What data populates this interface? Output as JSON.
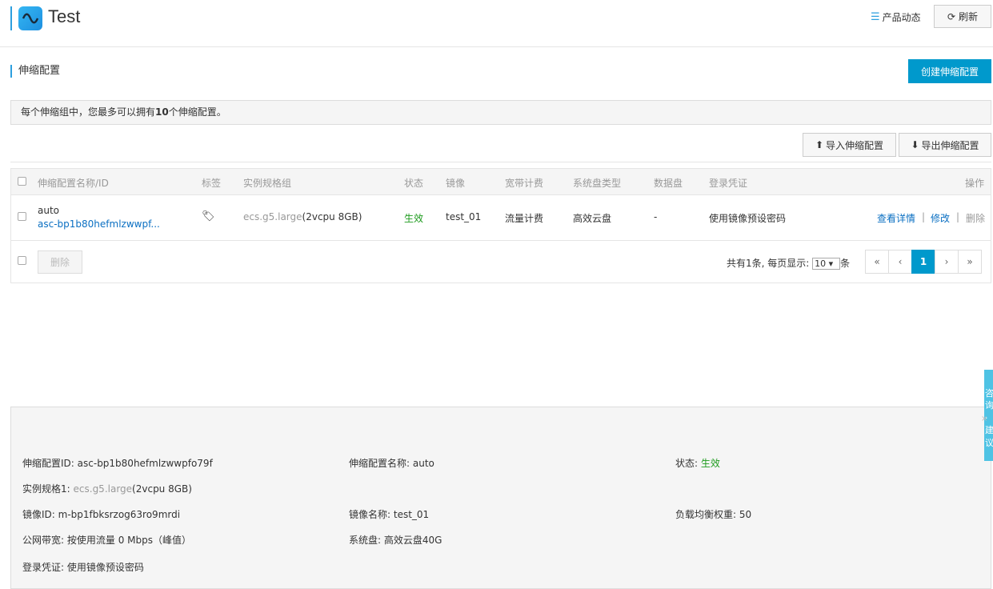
{
  "header": {
    "title": "Test",
    "product_news": "产品动态",
    "refresh": "刷新"
  },
  "section": {
    "title": "伸缩配置",
    "create_button": "创建伸缩配置"
  },
  "notice": {
    "prefix": "每个伸缩组中，您最多可以拥有",
    "count": "10",
    "suffix": "个伸缩配置。"
  },
  "toolbar": {
    "import": "导入伸缩配置",
    "export": "导出伸缩配置"
  },
  "table": {
    "columns": [
      "伸缩配置名称/ID",
      "标签",
      "实例规格组",
      "状态",
      "镜像",
      "宽带计费",
      "系统盘类型",
      "数据盘",
      "登录凭证",
      "操作"
    ],
    "rows": [
      {
        "name": "auto",
        "id": "asc-bp1b80hefmlzwwpf...",
        "spec_type": "ecs.g5.large",
        "spec_detail": "(2vcpu 8GB)",
        "status": "生效",
        "image": "test_01",
        "billing": "流量计费",
        "disk_type": "高效云盘",
        "data_disk": "-",
        "credential": "使用镜像预设密码",
        "actions": {
          "view": "查看详情",
          "sep": "|",
          "edit": "修改",
          "delete": "删除"
        }
      }
    ],
    "delete_button": "删除",
    "pagination": {
      "summary": "共有1条, 每页显示:",
      "page_size": "10 ▾",
      "unit": "条",
      "first": "«",
      "prev": "‹",
      "current": "1",
      "next": "›",
      "last": "»"
    }
  },
  "detail": {
    "config_id_label": "伸缩配置ID:",
    "config_id": "asc-bp1b80hefmlzwwpfo79f",
    "config_name_label": "伸缩配置名称:",
    "config_name": "auto",
    "status_label": "状态:",
    "status": "生效",
    "spec_label": "实例规格1:",
    "spec_type": "ecs.g5.large",
    "spec_detail": "(2vcpu 8GB)",
    "image_id_label": "镜像ID:",
    "image_id": "m-bp1fbksrzog63ro9mrdi",
    "image_name_label": "镜像名称:",
    "image_name": "test_01",
    "weight_label": "负载均衡权重:",
    "weight": "50",
    "bandwidth_label": "公网带宽:",
    "bandwidth": "按使用流量 0 Mbps（峰值）",
    "system_disk_label": "系统盘:",
    "system_disk": "高效云盘40G",
    "credential_label": "登录凭证:",
    "credential": "使用镜像预设密码"
  },
  "side_tab": {
    "text": "咨询·建议"
  },
  "colors": {
    "accent": "#0099cc",
    "link": "#0a6fc2",
    "status_green": "#1e9b1e"
  }
}
